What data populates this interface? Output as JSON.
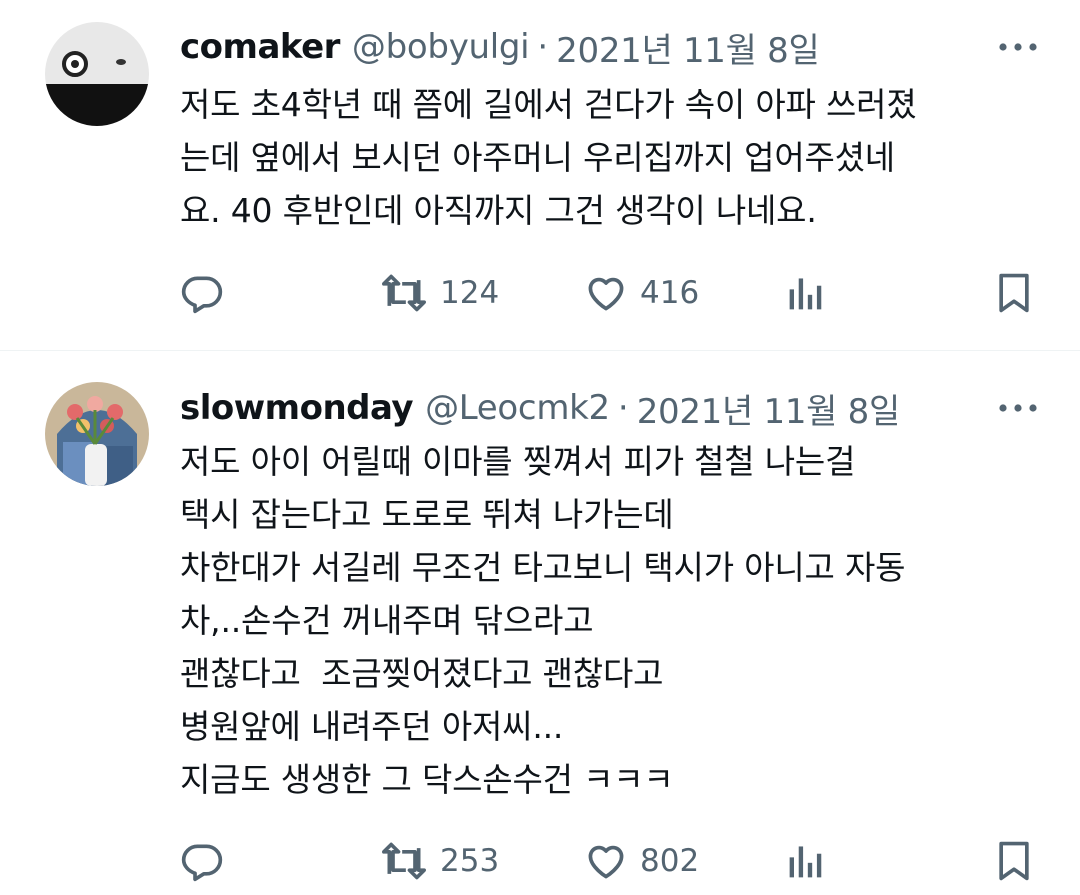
{
  "tweets": [
    {
      "display_name": "comaker",
      "handle": "@bobyulgi",
      "separator": "·",
      "date": "2021년 11월 8일",
      "avatar_icon": "avatar-face-icon",
      "lines": [
        "저도 초4학년 때 쯤에 길에서 걷다가 속이 아파 쓰러졌",
        "는데 옆에서 보시던 아주머니 우리집까지 업어주셨네",
        "요. 40 후반인데 아직까지 그건 생각이 나네요."
      ],
      "reply_count": "",
      "retweet_count": "124",
      "like_count": "416"
    },
    {
      "display_name": "slowmonday",
      "handle": "@Leocmk2",
      "separator": "·",
      "date": "2021년 11월 8일",
      "avatar_icon": "avatar-tulips-icon",
      "lines": [
        "저도 아이 어릴때 이마를 찢껴서 피가 철철 나는걸",
        "택시 잡는다고 도로로 뛰쳐 나가는데",
        "차한대가 서길레 무조건 타고보니 택시가 아니고 자동",
        "차,..손수건 꺼내주며 닦으라고",
        "괜찮다고  조금찢어졌다고 괜찮다고",
        "병원앞에 내려주던 아저씨...",
        "지금도 생생한 그 닥스손수건 ㅋㅋㅋ"
      ],
      "reply_count": "",
      "retweet_count": "253",
      "like_count": "802"
    }
  ],
  "icons": {
    "more": "more-icon",
    "reply": "reply-icon",
    "retweet": "retweet-icon",
    "like": "heart-icon",
    "views": "views-icon",
    "bookmark": "bookmark-icon"
  },
  "colors": {
    "text": "#0f1419",
    "secondary": "#536471",
    "divider": "#eff3f4"
  }
}
